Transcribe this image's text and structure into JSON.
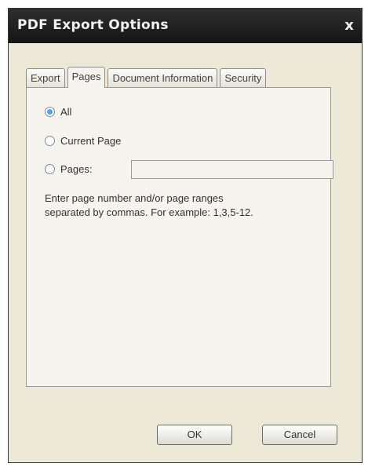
{
  "dialog": {
    "title": "PDF Export Options",
    "close_label": "x"
  },
  "tabs": [
    {
      "label": "Export",
      "active": false
    },
    {
      "label": "Pages",
      "active": true
    },
    {
      "label": "Document Information",
      "active": false
    },
    {
      "label": "Security",
      "active": false
    }
  ],
  "pages_tab": {
    "options": [
      {
        "label": "All",
        "checked": true
      },
      {
        "label": "Current Page",
        "checked": false
      },
      {
        "label": "Pages:",
        "checked": false
      }
    ],
    "pages_value": "",
    "hint_line1": "Enter page number and/or page ranges",
    "hint_line2": "separated by commas. For example: 1,3,5-12."
  },
  "buttons": {
    "ok": "OK",
    "cancel": "Cancel"
  },
  "colors": {
    "titlebar": "#1f1f1f",
    "dialog_bg": "#ece9d8",
    "panel_bg": "#f5f4ef",
    "radio_checked": "#5aa0e0"
  }
}
